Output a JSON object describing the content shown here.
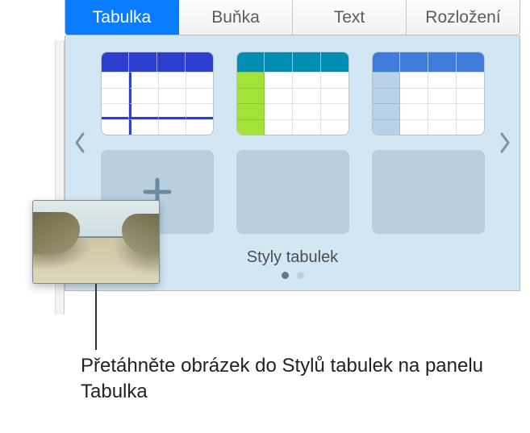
{
  "tabs": {
    "tabulka": "Tabulka",
    "bunka": "Buňka",
    "text": "Text",
    "rozlozeni": "Rozložení"
  },
  "carousel": {
    "caption": "Styly tabulek"
  },
  "callout": {
    "text": "Přetáhněte obrázek do Stylů tabulek na panelu Tabulka"
  },
  "icons": {
    "plus": "plus-icon",
    "chevron_left": "chevron-left-icon",
    "chevron_right": "chevron-right-icon"
  }
}
